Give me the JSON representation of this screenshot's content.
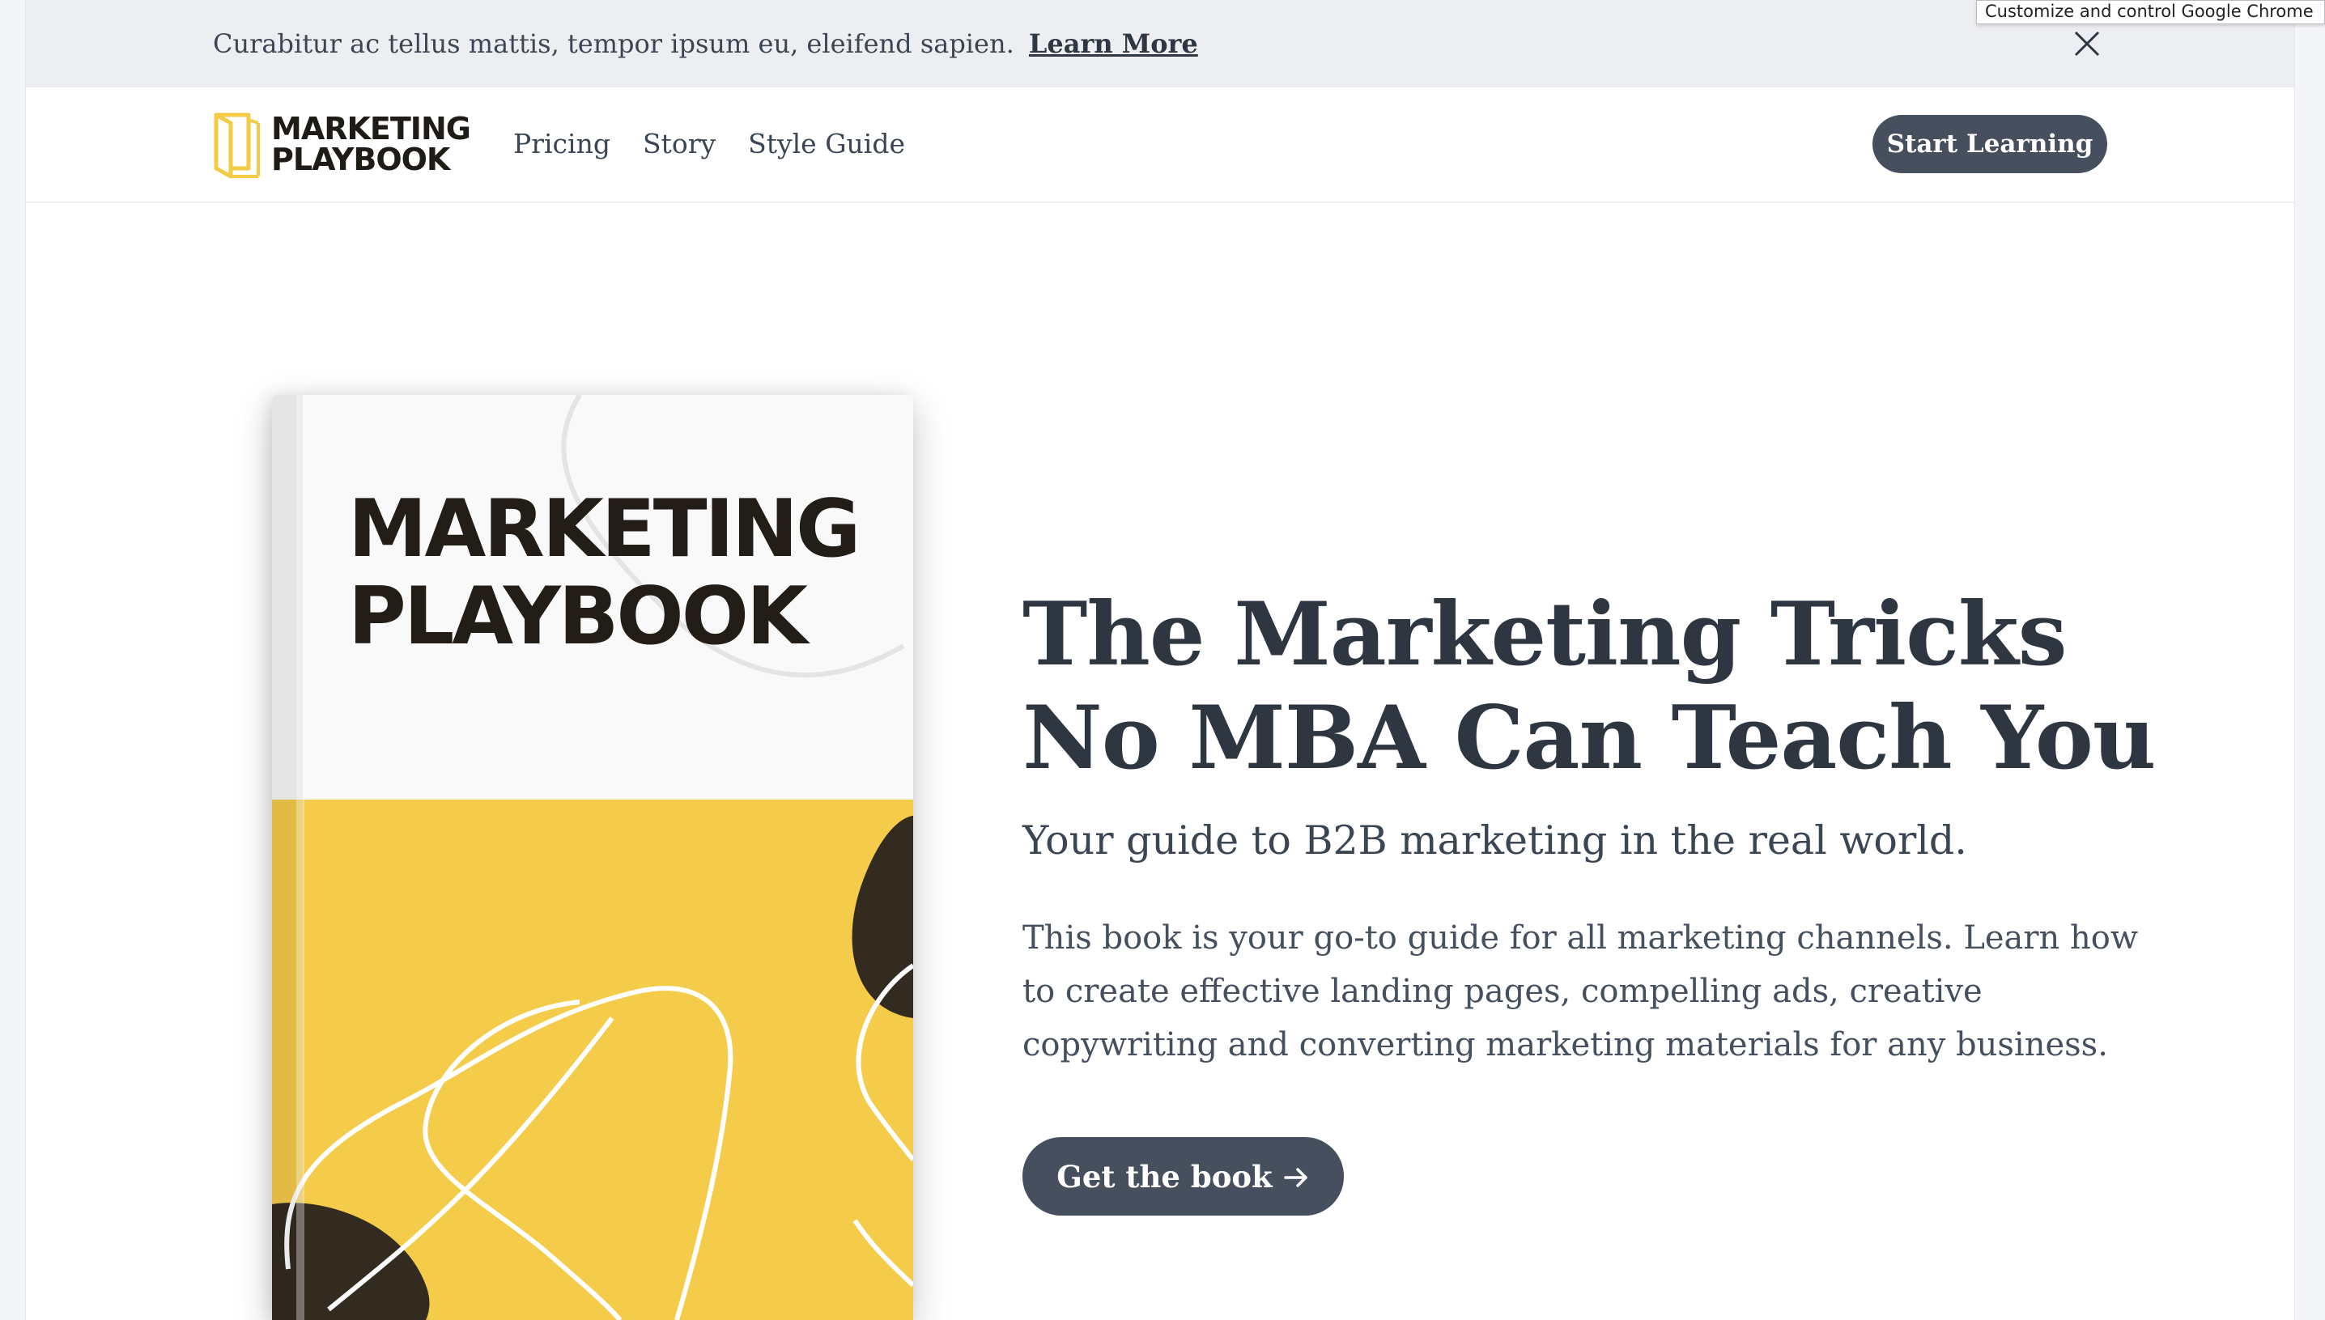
{
  "announcement": {
    "text": "Curabitur ac tellus mattis, tempor ipsum eu, eleifend sapien.",
    "link_label": "Learn More",
    "close_icon": "close-icon"
  },
  "nav": {
    "logo": {
      "line1": "MARKETING",
      "line2": "PLAYBOOK",
      "icon": "book-icon",
      "accent": "#f4cb45"
    },
    "links": [
      "Pricing",
      "Story",
      "Style Guide"
    ],
    "cta_label": "Start Learning"
  },
  "hero": {
    "book_cover": {
      "line1": "MARKETING",
      "line2": "PLAYBOOK",
      "cover_color": "#f5cb4a",
      "blob_color": "#342b20"
    },
    "headline": "The Marketing Tricks No MBA Can Teach You",
    "subhead": "Your guide to B2B marketing in the real world.",
    "body": "This book is your go-to guide for all marketing channels. Learn how to create effective landing pages, compelling ads, creative copywriting and converting marketing materials for any business.",
    "cta_label": "Get the book",
    "cta_icon": "arrow-right-icon"
  },
  "tooltip": {
    "text": "Customize and control Google Chrome"
  },
  "colors": {
    "button": "#454f5e",
    "heading": "#2e3642",
    "banner": "#edeef1"
  }
}
